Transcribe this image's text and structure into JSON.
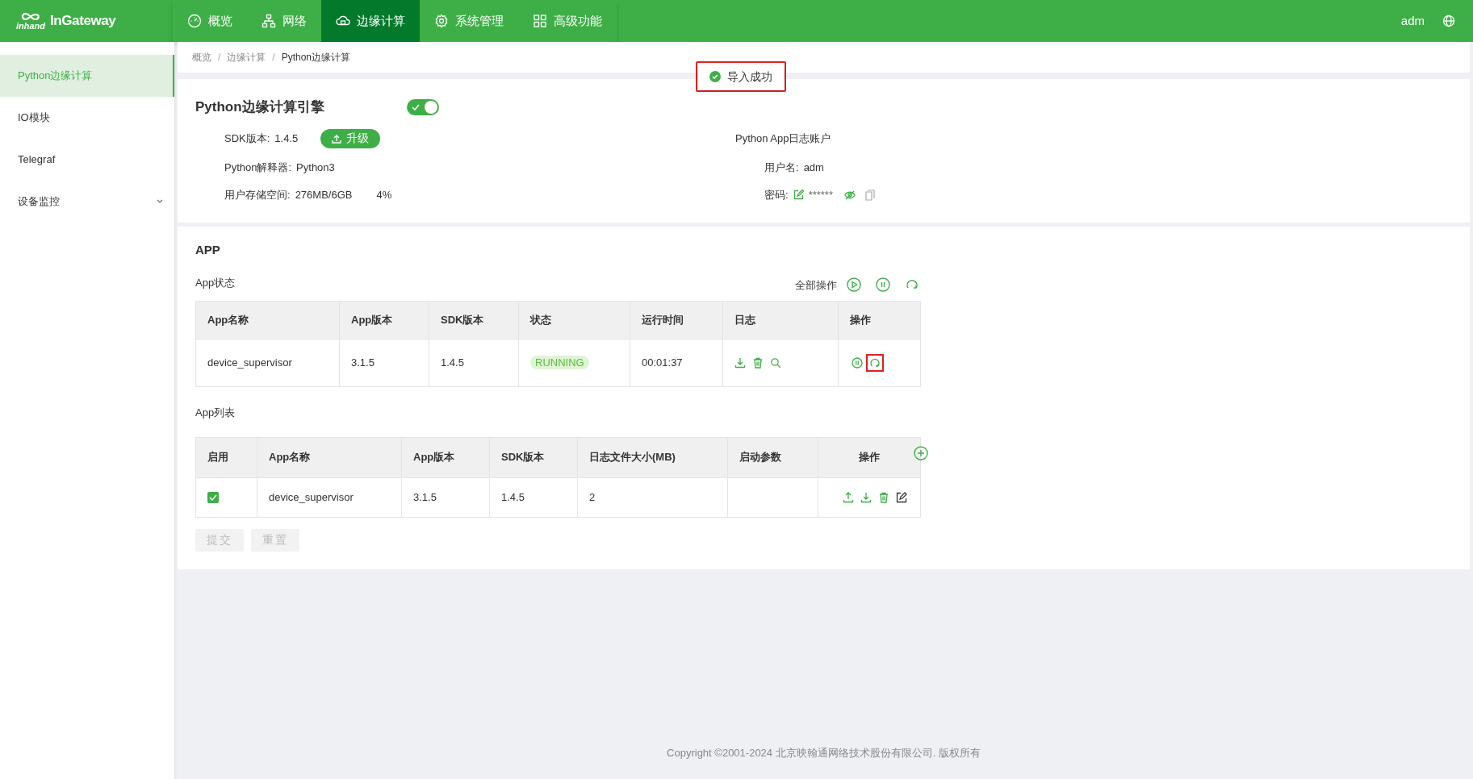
{
  "brand": {
    "mark": "inhand",
    "name": "InGateway"
  },
  "nav": [
    {
      "label": "概览",
      "kind": "gauge",
      "selected": false
    },
    {
      "label": "网络",
      "kind": "network",
      "selected": false
    },
    {
      "label": "边缘计算",
      "kind": "cloud",
      "selected": true
    },
    {
      "label": "系统管理",
      "kind": "gear",
      "selected": false
    },
    {
      "label": "高级功能",
      "kind": "grid",
      "selected": false
    }
  ],
  "user": "adm",
  "sidebar": {
    "items": [
      {
        "label": "Python边缘计算",
        "selected": true
      },
      {
        "label": "IO模块",
        "selected": false
      },
      {
        "label": "Telegraf",
        "selected": false
      },
      {
        "label": "设备监控",
        "selected": false,
        "expanded": false
      }
    ]
  },
  "breadcrumb": [
    {
      "kind": "link",
      "text": "概览"
    },
    {
      "kind": "separator",
      "text": "/"
    },
    {
      "kind": "link",
      "text": "边缘计算"
    },
    {
      "kind": "separator",
      "text": "/"
    },
    {
      "kind": "current",
      "text": "Python边缘计算"
    }
  ],
  "toast": {
    "text": "导入成功"
  },
  "engine": {
    "title": "Python边缘计算引擎",
    "on": true,
    "sdk_label": "SDK版本:",
    "sdk_value": "1.4.5",
    "upgrade_button": "升级",
    "interpreter_label": "Python解释器:",
    "interpreter_value": "Python3",
    "storage_label": "用户存储空间:",
    "storage_value": "276MB/6GB",
    "storage_percent": "4%",
    "log_account_title": "Python App日志账户",
    "username_label": "用户名:",
    "username_value": "adm",
    "password_label": "密码:",
    "password_value": "******"
  },
  "app": {
    "title": "APP",
    "status_label": "App状态",
    "all_actions_label": "全部操作",
    "status_table": {
      "columns": [
        "App名称",
        "App版本",
        "SDK版本",
        "状态",
        "运行时间",
        "日志",
        "操作"
      ],
      "rows": [
        {
          "name": "device_supervisor",
          "app_version": "3.1.5",
          "sdk_version": "1.4.5",
          "status": "RUNNING",
          "uptime": "00:01:37"
        }
      ]
    },
    "list_label": "App列表",
    "list_table": {
      "columns": [
        "启用",
        "App名称",
        "App版本",
        "SDK版本",
        "日志文件大小(MB)",
        "启动参数",
        "操作"
      ],
      "rows": [
        {
          "checked": true,
          "name": "device_supervisor",
          "app_version": "3.1.5",
          "sdk_version": "1.4.5",
          "log_size": "2"
        }
      ]
    },
    "buttons": [
      {
        "label": "提交",
        "disabled": true
      },
      {
        "label": "重置",
        "disabled": true
      }
    ]
  },
  "footer": "Copyright ©2001-2024 北京映翰通网络技术股份有限公司. 版权所有"
}
